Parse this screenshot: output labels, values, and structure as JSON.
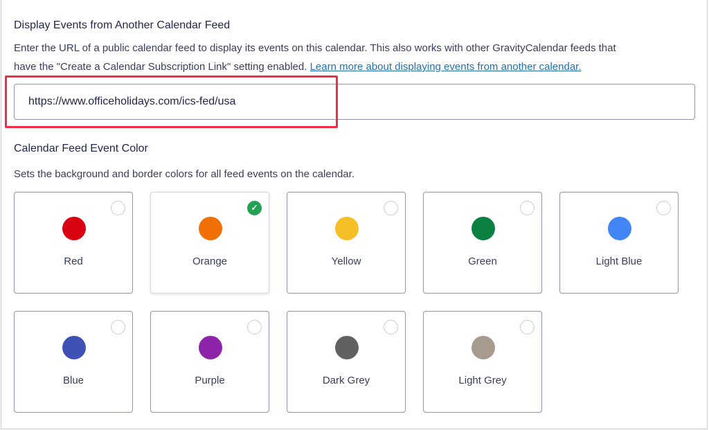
{
  "feed": {
    "title": "Display Events from Another Calendar Feed",
    "desc_line1": "Enter the URL of a public calendar feed to display its events on this calendar. This also works with other GravityCalendar feeds that",
    "desc_line2": "have the \"Create a Calendar Subscription Link\" setting enabled.",
    "link": "Learn more about displaying events from another calendar.",
    "url_value": "https://www.officeholidays.com/ics-fed/usa"
  },
  "color": {
    "title": "Calendar Feed Event Color",
    "desc": "Sets the background and border colors for all feed events on the calendar.",
    "selected": "Orange",
    "options": [
      {
        "label": "Red",
        "color": "#d90012"
      },
      {
        "label": "Orange",
        "color": "#f07005"
      },
      {
        "label": "Yellow",
        "color": "#f6bf26"
      },
      {
        "label": "Green",
        "color": "#0b8043"
      },
      {
        "label": "Light Blue",
        "color": "#4285f4"
      },
      {
        "label": "Blue",
        "color": "#3f51b5"
      },
      {
        "label": "Purple",
        "color": "#8e24aa"
      },
      {
        "label": "Dark Grey",
        "color": "#616161"
      },
      {
        "label": "Light Grey",
        "color": "#a79b8e"
      }
    ]
  }
}
